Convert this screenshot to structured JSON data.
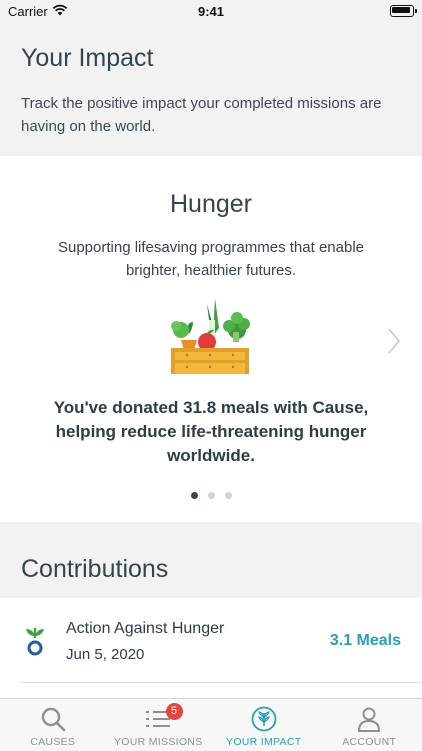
{
  "status_bar": {
    "carrier": "Carrier",
    "time": "9:41"
  },
  "header": {
    "title": "Your Impact",
    "subtitle": "Track the positive impact your completed missions are having on the world."
  },
  "impact_card": {
    "cause_title": "Hunger",
    "description": "Supporting lifesaving programmes that enable brighter, healthier futures.",
    "impact_statement": "You've donated 31.8 meals with Cause, helping reduce life-threatening hunger worldwide.",
    "illustration_icon": "vegetable-crate-icon",
    "page_count": 3,
    "active_page": 1
  },
  "contributions": {
    "title": "Contributions",
    "items": [
      {
        "org": "Action Against Hunger",
        "date": "Jun 5, 2020",
        "amount": "3.1 Meals",
        "logo_icon": "action-against-hunger-logo"
      }
    ]
  },
  "tab_bar": {
    "tabs": [
      {
        "label": "CAUSES",
        "icon": "search-icon"
      },
      {
        "label": "YOUR MISSIONS",
        "icon": "list-icon",
        "badge": "5"
      },
      {
        "label": "YOUR IMPACT",
        "icon": "leaf-circle-icon"
      },
      {
        "label": "ACCOUNT",
        "icon": "person-icon"
      }
    ],
    "active": "YOUR IMPACT"
  },
  "colors": {
    "accent": "#2aa0b8",
    "badge": "#e8453c",
    "text": "#34454f"
  }
}
